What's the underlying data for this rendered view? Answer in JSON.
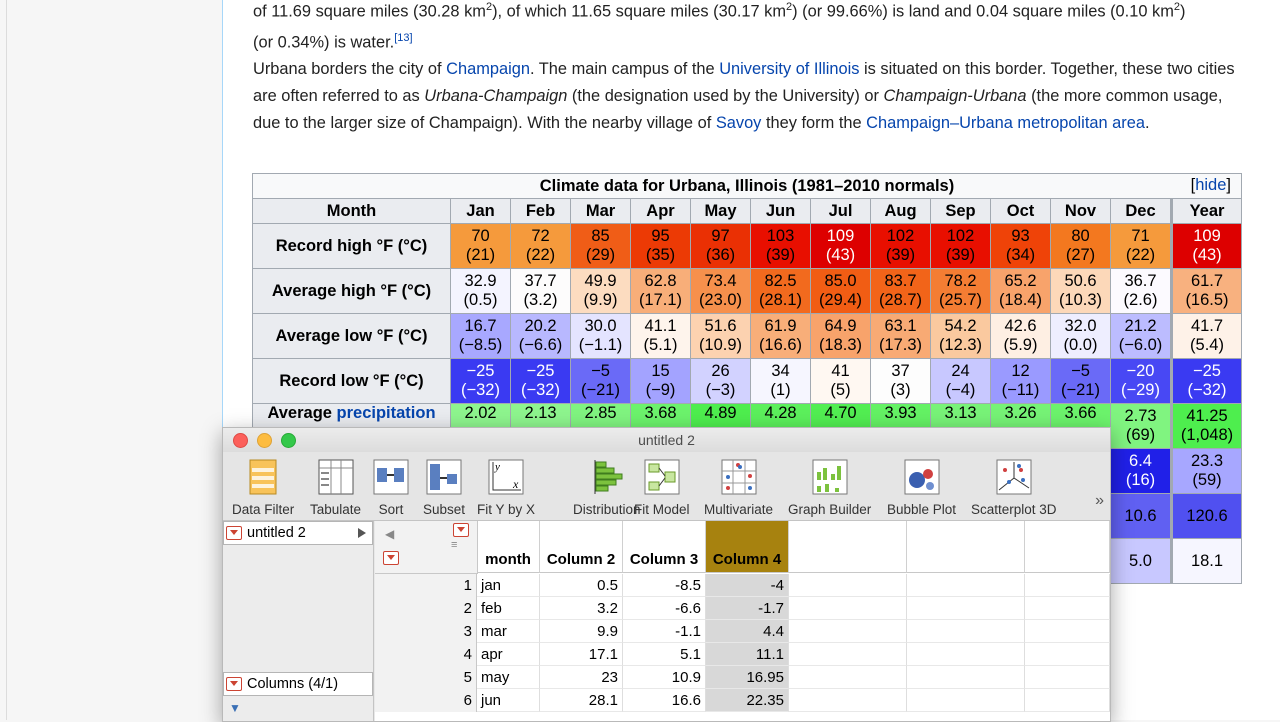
{
  "article": {
    "p1": {
      "pre": "of 11.69 square miles (30.28 km",
      "sup1": "2",
      "mid1": "), of which 11.65 square miles (30.17 km",
      "sup2": "2",
      "mid2": ") (or 99.66%) is land and 0.04 square miles (0.10 km",
      "sup3": "2",
      "post": ")",
      "line2": "(or 0.34%) is water.",
      "ref": "[13]"
    },
    "p2": {
      "t1": "Urbana borders the city of ",
      "l1": "Champaign",
      "t2": ". The main campus of the ",
      "l2": "University of Illinois",
      "t3": " is situated on this border. Together, these two cities are often referred to as ",
      "i1": "Urbana-Champaign",
      "t4": " (the designation used by the University) or ",
      "i2": "Champaign-Urbana",
      "t5": " (the more common usage, due to the larger size of Champaign). With the nearby village of ",
      "l3": "Savoy",
      "t6": " they form the ",
      "l4": "Champaign–Urbana metropolitan area",
      "t7": "."
    }
  },
  "climate": {
    "caption": "Climate data for Urbana, Illinois (1981–2010 normals)",
    "hide": "hide",
    "hide_open": "[",
    "hide_close": "]",
    "header": [
      "Month",
      "Jan",
      "Feb",
      "Mar",
      "Apr",
      "May",
      "Jun",
      "Jul",
      "Aug",
      "Sep",
      "Oct",
      "Nov",
      "Dec",
      "Year"
    ],
    "rows": [
      {
        "label": "Record high °F (°C)",
        "cells": [
          [
            "70",
            "(21)"
          ],
          [
            "72",
            "(22)"
          ],
          [
            "85",
            "(29)"
          ],
          [
            "95",
            "(35)"
          ],
          [
            "97",
            "(36)"
          ],
          [
            "103",
            "(39)"
          ],
          [
            "109",
            "(43)"
          ],
          [
            "102",
            "(39)"
          ],
          [
            "102",
            "(39)"
          ],
          [
            "93",
            "(34)"
          ],
          [
            "80",
            "(27)"
          ],
          [
            "71",
            "(22)"
          ],
          [
            "109",
            "(43)"
          ]
        ],
        "colors": [
          "#f59a3c",
          "#f59a3c",
          "#f05d17",
          "#ec3a05",
          "#ea3004",
          "#e80f00",
          "#dd0000",
          "#e80f00",
          "#e80f00",
          "#ef4308",
          "#f3781f",
          "#f59a3c",
          "#dd0000"
        ]
      },
      {
        "label": "Average high °F (°C)",
        "cells": [
          [
            "32.9",
            "(0.5)"
          ],
          [
            "37.7",
            "(3.2)"
          ],
          [
            "49.9",
            "(9.9)"
          ],
          [
            "62.8",
            "(17.1)"
          ],
          [
            "73.4",
            "(23.0)"
          ],
          [
            "82.5",
            "(28.1)"
          ],
          [
            "85.0",
            "(29.4)"
          ],
          [
            "83.7",
            "(28.7)"
          ],
          [
            "78.2",
            "(25.7)"
          ],
          [
            "65.2",
            "(18.4)"
          ],
          [
            "50.6",
            "(10.3)"
          ],
          [
            "36.7",
            "(2.6)"
          ],
          [
            "61.7",
            "(16.5)"
          ]
        ],
        "colors": [
          "#f4f4ff",
          "#fdfcfc",
          "#fcdcc0",
          "#f8ae79",
          "#f6904c",
          "#f26a1e",
          "#f15d14",
          "#f26419",
          "#f47d33",
          "#f8a36b",
          "#fcd8b9",
          "#fcfaff",
          "#f8b17f"
        ]
      },
      {
        "label": "Average low °F (°C)",
        "cells": [
          [
            "16.7",
            "(−8.5)"
          ],
          [
            "20.2",
            "(−6.6)"
          ],
          [
            "30.0",
            "(−1.1)"
          ],
          [
            "41.1",
            "(5.1)"
          ],
          [
            "51.6",
            "(10.9)"
          ],
          [
            "61.9",
            "(16.6)"
          ],
          [
            "64.9",
            "(18.3)"
          ],
          [
            "63.1",
            "(17.3)"
          ],
          [
            "54.2",
            "(12.3)"
          ],
          [
            "42.6",
            "(5.9)"
          ],
          [
            "32.0",
            "(0.0)"
          ],
          [
            "21.2",
            "(−6.0)"
          ],
          [
            "41.7",
            "(5.4)"
          ]
        ],
        "colors": [
          "#a8a8ff",
          "#b8b8ff",
          "#e4e4ff",
          "#fef4ec",
          "#fcd2b0",
          "#f8ae79",
          "#f8a36b",
          "#f8aa74",
          "#fac99f",
          "#feefe3",
          "#eeeeff",
          "#bcbcff",
          "#fef2e8"
        ]
      },
      {
        "label": "Record low °F (°C)",
        "cells": [
          [
            "−25",
            "(−32)"
          ],
          [
            "−25",
            "(−32)"
          ],
          [
            "−5",
            "(−21)"
          ],
          [
            "15",
            "(−9)"
          ],
          [
            "26",
            "(−3)"
          ],
          [
            "34",
            "(1)"
          ],
          [
            "41",
            "(5)"
          ],
          [
            "37",
            "(3)"
          ],
          [
            "24",
            "(−4)"
          ],
          [
            "12",
            "(−11)"
          ],
          [
            "−5",
            "(−21)"
          ],
          [
            "−20",
            "(−29)"
          ],
          [
            "−25",
            "(−32)"
          ]
        ],
        "colors": [
          "#3a3af2",
          "#3a3af2",
          "#6a6af7",
          "#a3a3ff",
          "#d2d2ff",
          "#f6f6ff",
          "#fff8f2",
          "#fdfdfd",
          "#c8c8ff",
          "#9a9aff",
          "#6a6af7",
          "#4848f4",
          "#3a3af2"
        ]
      },
      {
        "label_pre": "Average ",
        "label_link": "precipitation",
        "cells": [
          [
            "2.02",
            ""
          ],
          [
            "2.13",
            ""
          ],
          [
            "2.85",
            ""
          ],
          [
            "3.68",
            ""
          ],
          [
            "4.89",
            ""
          ],
          [
            "4.28",
            ""
          ],
          [
            "4.70",
            ""
          ],
          [
            "3.93",
            ""
          ],
          [
            "3.13",
            ""
          ],
          [
            "3.26",
            ""
          ],
          [
            "3.66",
            ""
          ],
          [
            "2.73",
            "(69)"
          ],
          [
            "41.25",
            "(1,048)"
          ]
        ],
        "colors": [
          "#8ef58e",
          "#8ef58e",
          "#80f480",
          "#6cf36c",
          "#4eee4e",
          "#5cf05c",
          "#52ee52",
          "#64f264",
          "#78f378",
          "#76f376",
          "#6cf36c",
          "#80f480",
          "#4eee4e"
        ]
      },
      {
        "cells": [
          [
            "6.4",
            "(16)"
          ],
          [
            "23.3",
            "(59)"
          ]
        ],
        "colors": [
          "#2020e8",
          "#a7a7ff"
        ]
      },
      {
        "cells": [
          [
            "10.6",
            ""
          ],
          [
            "120.6",
            ""
          ]
        ],
        "colors": [
          "#6060f2",
          "#5050f0"
        ]
      },
      {
        "cells": [
          [
            "5.0",
            ""
          ],
          [
            "18.1",
            ""
          ]
        ],
        "colors": [
          "#c8c8ff",
          "#f6f6ff"
        ]
      }
    ]
  },
  "jmp": {
    "title": "untitled 2",
    "tools": [
      {
        "label": "Data Filter",
        "icon": "data-filter-icon"
      },
      {
        "label": "Tabulate",
        "icon": "tabulate-icon"
      },
      {
        "label": "Sort",
        "icon": "sort-icon"
      },
      {
        "label": "Subset",
        "icon": "subset-icon"
      },
      {
        "label": "Fit Y by X",
        "icon": "fit-y-by-x-icon"
      },
      {
        "label": "Distribution",
        "icon": "distribution-icon"
      },
      {
        "label": "Fit Model",
        "icon": "fit-model-icon"
      },
      {
        "label": "Multivariate",
        "icon": "multivariate-icon"
      },
      {
        "label": "Graph Builder",
        "icon": "graph-builder-icon"
      },
      {
        "label": "Bubble Plot",
        "icon": "bubble-plot-icon"
      },
      {
        "label": "Scatterplot 3D",
        "icon": "scatterplot-3d-icon"
      }
    ],
    "more": "»",
    "table_panel": "untitled 2",
    "columns_panel": "Columns (4/1)",
    "columns": [
      "month",
      "Column 2",
      "Column 3",
      "Column 4"
    ],
    "rows": [
      [
        "1",
        "jan",
        "0.5",
        "-8.5",
        "-4"
      ],
      [
        "2",
        "feb",
        "3.2",
        "-6.6",
        "-1.7"
      ],
      [
        "3",
        "mar",
        "9.9",
        "-1.1",
        "4.4"
      ],
      [
        "4",
        "apr",
        "17.1",
        "5.1",
        "11.1"
      ],
      [
        "5",
        "may",
        "23",
        "10.9",
        "16.95"
      ],
      [
        "6",
        "jun",
        "28.1",
        "16.6",
        "22.35"
      ]
    ]
  }
}
